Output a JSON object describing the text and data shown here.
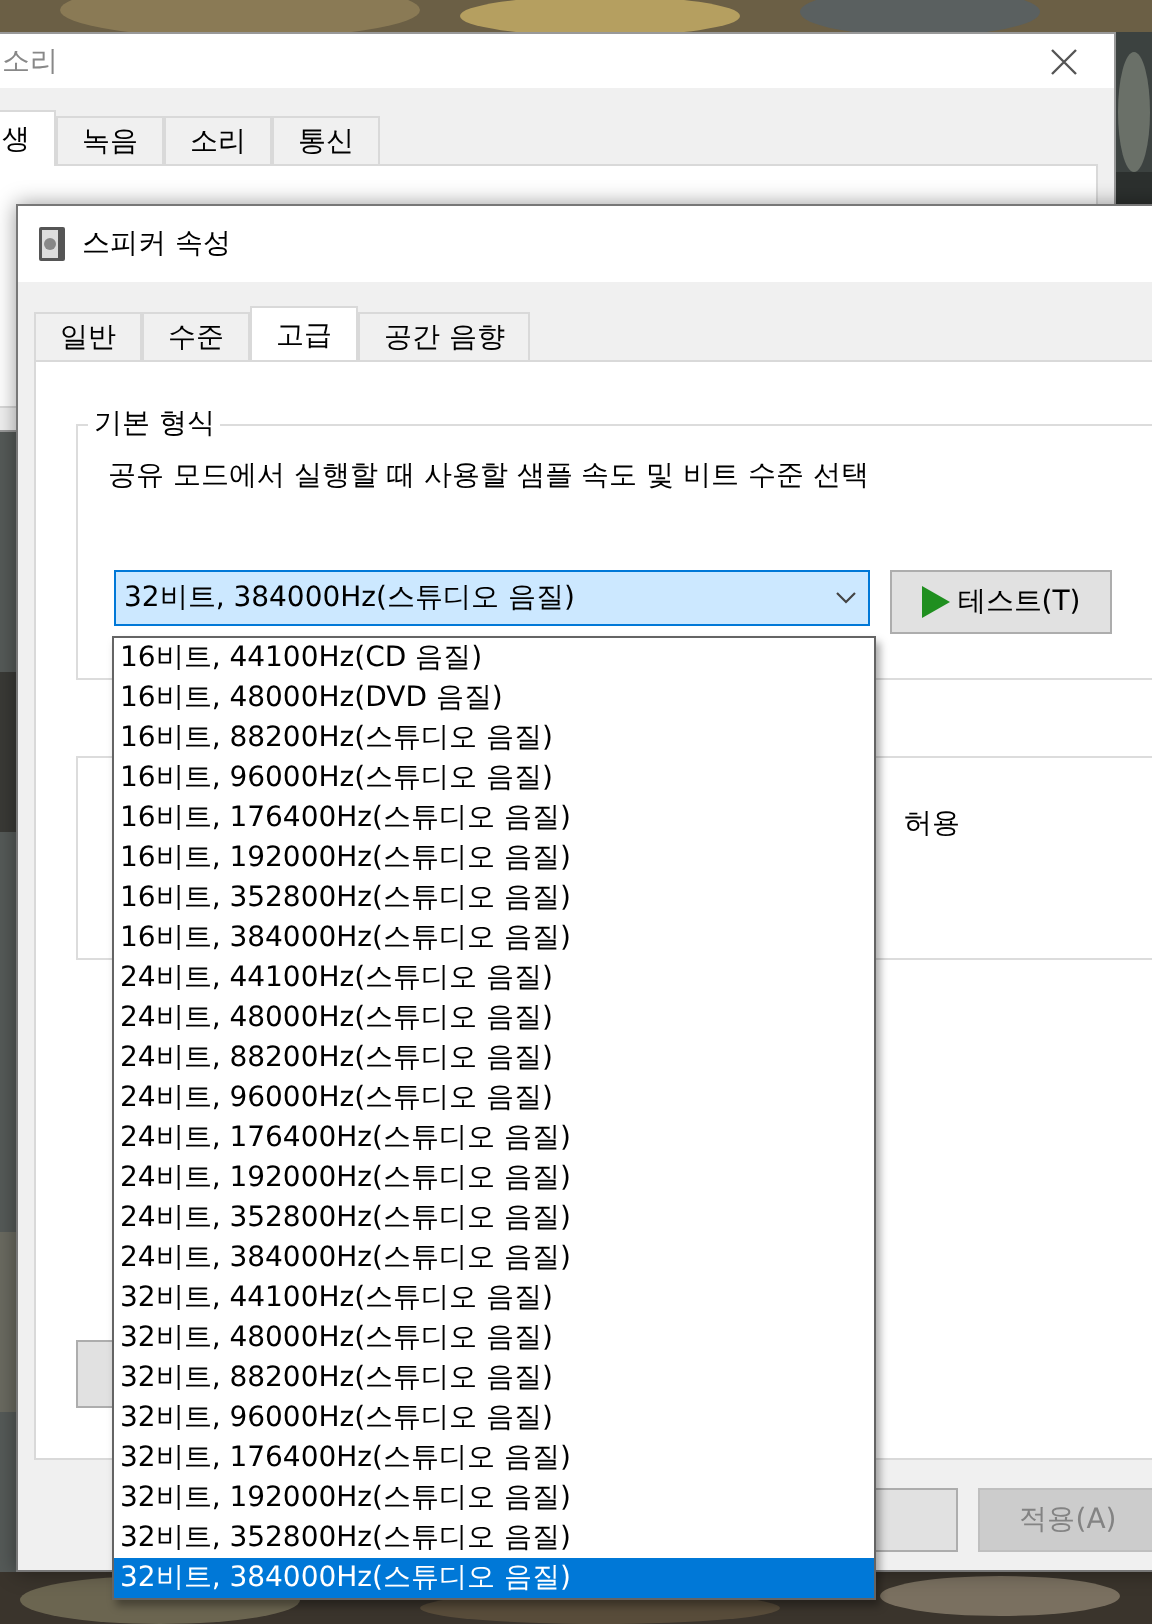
{
  "back_window": {
    "title": "소리",
    "tabs": [
      {
        "label": "생",
        "selected": true
      },
      {
        "label": "녹음",
        "selected": false
      },
      {
        "label": "소리",
        "selected": false
      },
      {
        "label": "통신",
        "selected": false
      }
    ]
  },
  "window": {
    "title": "스피커 속성",
    "tabs": [
      {
        "label": "일반",
        "selected": false
      },
      {
        "label": "수준",
        "selected": false
      },
      {
        "label": "고급",
        "selected": true
      },
      {
        "label": "공간 음향",
        "selected": false
      }
    ],
    "default_format": {
      "group_label": "기본 형식",
      "description": "공유 모드에서 실행할 때 사용할 샘플 속도 및 비트 수준 선택",
      "combo": {
        "value": "32비트, 384000Hz(스튜디오 음질)",
        "expanded": true
      },
      "test_button": "테스트(T)",
      "options": [
        {
          "label": "16비트, 44100Hz(CD 음질)",
          "selected": false
        },
        {
          "label": "16비트, 48000Hz(DVD 음질)",
          "selected": false
        },
        {
          "label": "16비트, 88200Hz(스튜디오 음질)",
          "selected": false
        },
        {
          "label": "16비트, 96000Hz(스튜디오 음질)",
          "selected": false
        },
        {
          "label": "16비트, 176400Hz(스튜디오 음질)",
          "selected": false
        },
        {
          "label": "16비트, 192000Hz(스튜디오 음질)",
          "selected": false
        },
        {
          "label": "16비트, 352800Hz(스튜디오 음질)",
          "selected": false
        },
        {
          "label": "16비트, 384000Hz(스튜디오 음질)",
          "selected": false
        },
        {
          "label": "24비트, 44100Hz(스튜디오 음질)",
          "selected": false
        },
        {
          "label": "24비트, 48000Hz(스튜디오 음질)",
          "selected": false
        },
        {
          "label": "24비트, 88200Hz(스튜디오 음질)",
          "selected": false
        },
        {
          "label": "24비트, 96000Hz(스튜디오 음질)",
          "selected": false
        },
        {
          "label": "24비트, 176400Hz(스튜디오 음질)",
          "selected": false
        },
        {
          "label": "24비트, 192000Hz(스튜디오 음질)",
          "selected": false
        },
        {
          "label": "24비트, 352800Hz(스튜디오 음질)",
          "selected": false
        },
        {
          "label": "24비트, 384000Hz(스튜디오 음질)",
          "selected": false
        },
        {
          "label": "32비트, 44100Hz(스튜디오 음질)",
          "selected": false
        },
        {
          "label": "32비트, 48000Hz(스튜디오 음질)",
          "selected": false
        },
        {
          "label": "32비트, 88200Hz(스튜디오 음질)",
          "selected": false
        },
        {
          "label": "32비트, 96000Hz(스튜디오 음질)",
          "selected": false
        },
        {
          "label": "32비트, 176400Hz(스튜디오 음질)",
          "selected": false
        },
        {
          "label": "32비트, 192000Hz(스튜디오 음질)",
          "selected": false
        },
        {
          "label": "32비트, 352800Hz(스튜디오 음질)",
          "selected": false
        },
        {
          "label": "32비트, 384000Hz(스튜디오 음질)",
          "selected": true
        }
      ]
    },
    "exclusive_group": {
      "text": "허용"
    },
    "apply_button": {
      "label": "적용(A)",
      "disabled": true
    }
  }
}
